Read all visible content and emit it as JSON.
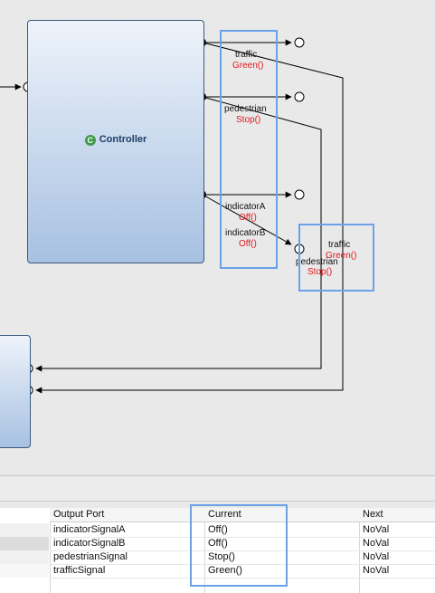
{
  "diagram": {
    "controller": {
      "title": "Controller",
      "icon": "class-icon"
    },
    "port_labels": {
      "traffic": "traffic",
      "pedestrian": "pedestrian",
      "indicatorA": "indicatorA",
      "indicatorB": "indicatorB",
      "traffic2": "traffic",
      "pedestrian2": "pedestrian"
    },
    "port_values": {
      "traffic": "Green()",
      "pedestrian": "Stop()",
      "indicatorA": "Off()",
      "indicatorB": "Off()",
      "traffic2": "Green()",
      "pedestrian2": "Stop()"
    },
    "colors": {
      "highlight": "#6aa1e8",
      "value": "#e0191e",
      "block": "#a7c1e2"
    }
  },
  "table": {
    "headers": {
      "port": "Output Port",
      "current": "Current",
      "next": "Next"
    },
    "rows": [
      {
        "port": "indicatorSignalA",
        "current": "Off()",
        "next": "NoVal"
      },
      {
        "port": "indicatorSignalB",
        "current": "Off()",
        "next": "NoVal"
      },
      {
        "port": "pedestrianSignal",
        "current": "Stop()",
        "next": "NoVal"
      },
      {
        "port": "trafficSignal",
        "current": "Green()",
        "next": "NoVal"
      }
    ]
  }
}
